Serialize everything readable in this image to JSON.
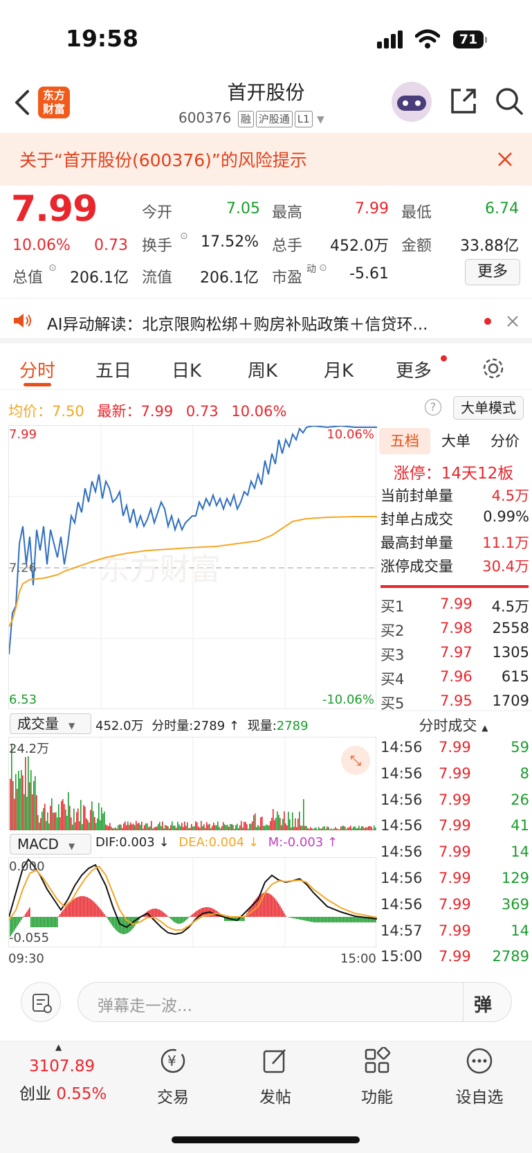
{
  "status_bar": {
    "time": "19:58",
    "battery": "71"
  },
  "header": {
    "title": "首开股份",
    "code": "600376",
    "tags": [
      "融",
      "沪股通",
      "L1"
    ]
  },
  "risk_banner": {
    "text": "关于“首开股份(600376)”的风险提示"
  },
  "quote": {
    "price": "7.99",
    "pct": "10.06%",
    "change": "0.73",
    "open_label": "今开",
    "open": "7.05",
    "high_label": "最高",
    "high": "7.99",
    "low_label": "最低",
    "low": "6.74",
    "turnover_label": "换手",
    "turnover": "17.52%",
    "volume_label": "总手",
    "volume": "452.0万",
    "amount_label": "金额",
    "amount": "33.88亿",
    "mktcap_label": "总值",
    "mktcap": "206.1亿",
    "float_label": "流值",
    "float": "206.1亿",
    "pe_label": "市盈",
    "pe_sup": "动",
    "pe": "-5.61",
    "more": "更多"
  },
  "ai_bar": {
    "text": "AI异动解读：北京限购松绑＋购房补贴政策＋信贷环..."
  },
  "tabs": [
    "分时",
    "五日",
    "日K",
    "周K",
    "月K",
    "更多"
  ],
  "chart_info": {
    "avg_label": "均价：",
    "avg": "7.50",
    "latest_label": "最新：",
    "latest": "7.99",
    "change": "0.73",
    "pct": "10.06%",
    "mode_btn": "大单模式"
  },
  "main_chart": {
    "y_top": "7.99",
    "y_bottom": "6.53",
    "y_mid": "7.26",
    "pct_top": "10.06%",
    "pct_bottom": "-10.06%",
    "watermark": "东方财富"
  },
  "volume_chart": {
    "selector": "成交量",
    "total": "452.0万",
    "period_label": "分时量:",
    "period": "2789 ↑",
    "now_label": "现量:",
    "now": "2789",
    "max": "24.2万"
  },
  "macd_chart": {
    "selector": "MACD",
    "dif": "DIF:0.003 ↓",
    "dea": "DEA:0.004 ↓",
    "m": "M:-0.003 ↑",
    "top": "0.000",
    "bottom": "-0.055",
    "t_start": "09:30",
    "t_end": "15:00"
  },
  "side_tabs": [
    "五档",
    "大单",
    "分价"
  ],
  "limit": {
    "label": "涨停：",
    "value": "14天12板"
  },
  "seal": [
    {
      "label": "当前封单量",
      "value": "4.5万"
    },
    {
      "label": "封单占成交",
      "value": "0.99%"
    },
    {
      "label": "最高封单量",
      "value": "11.1万"
    },
    {
      "label": "涨停成交量",
      "value": "30.4万"
    }
  ],
  "bids": [
    {
      "label": "买1",
      "price": "7.99",
      "vol": "4.5万"
    },
    {
      "label": "买2",
      "price": "7.98",
      "vol": "2558"
    },
    {
      "label": "买3",
      "price": "7.97",
      "vol": "1305"
    },
    {
      "label": "买4",
      "price": "7.96",
      "vol": "615"
    },
    {
      "label": "买5",
      "price": "7.95",
      "vol": "1709"
    }
  ],
  "ticks_title": "分时成交",
  "ticks": [
    {
      "t": "14:56",
      "p": "7.99",
      "v": "59"
    },
    {
      "t": "14:56",
      "p": "7.99",
      "v": "8"
    },
    {
      "t": "14:56",
      "p": "7.99",
      "v": "26"
    },
    {
      "t": "14:56",
      "p": "7.99",
      "v": "41"
    },
    {
      "t": "14:56",
      "p": "7.99",
      "v": "14"
    },
    {
      "t": "14:56",
      "p": "7.99",
      "v": "129"
    },
    {
      "t": "14:56",
      "p": "7.99",
      "v": "369"
    },
    {
      "t": "14:57",
      "p": "7.99",
      "v": "14"
    },
    {
      "t": "15:00",
      "p": "7.99",
      "v": "2789"
    }
  ],
  "danmu": {
    "placeholder": "弹幕走一波...",
    "send": "弹"
  },
  "nav": {
    "index_value": "3107.89",
    "index_name": "创业",
    "index_pct": "0.55%",
    "items": [
      "交易",
      "发帖",
      "功能",
      "设自选"
    ]
  },
  "colors": {
    "up": "#e8262c",
    "down": "#1a9c2c",
    "accent": "#e8501b",
    "avg_line": "#f5a623",
    "price_line": "#2f6fc0"
  }
}
